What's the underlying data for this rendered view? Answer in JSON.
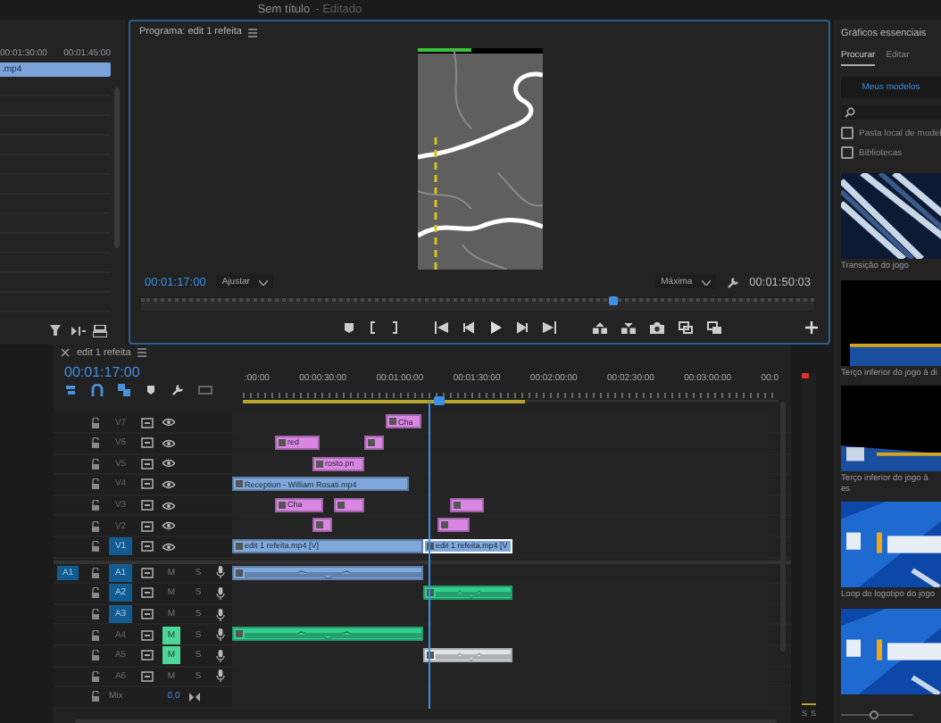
{
  "app_title": {
    "name": "Sem título",
    "status": "- Editado"
  },
  "project_panel": {
    "ruler": [
      "00:01:30:00",
      "00:01:45:00"
    ],
    "clip": ".mp4"
  },
  "program_monitor": {
    "title": "Programa: edit 1 refeita",
    "timecode": "00:01:17:00",
    "fit": "Ajustar",
    "quality": "Máxima",
    "duration": "00:01:50:03",
    "scrubber": {
      "level": 0.7
    }
  },
  "timeline": {
    "tab": "edit 1 refeita",
    "timecode": "00:01:17:00",
    "ruler": [
      ":00:00",
      "00:00:30:00",
      "00:01:00:00",
      "00:01:30:00",
      "00:02:00:00",
      "00:02:30:00",
      "00:03:00:00",
      "00:0"
    ],
    "playhead": {
      "level": 0.366
    },
    "tracks": [
      {
        "label": "V7",
        "kind": "video",
        "targeted": false,
        "clips": [
          {
            "kind": "graphic",
            "label": "Cha",
            "color": "#d986e2",
            "selected": false
          }
        ]
      },
      {
        "label": "V6",
        "kind": "video",
        "targeted": false,
        "clips": [
          {
            "kind": "graphic",
            "label": "red",
            "color": "#d986e2",
            "selected": false
          },
          {
            "kind": "graphic",
            "color": "#d986e2",
            "selected": false
          }
        ]
      },
      {
        "label": "V5",
        "kind": "video",
        "targeted": false,
        "clips": [
          {
            "kind": "graphic",
            "label": "rosto.pn",
            "color": "#d986e2",
            "selected": false
          }
        ]
      },
      {
        "label": "V4",
        "kind": "video",
        "targeted": false,
        "clips": [
          {
            "kind": "video",
            "label": "Reception - William Rosati.mp4",
            "color": "#7ea8dc",
            "selected": false
          }
        ]
      },
      {
        "label": "V3",
        "kind": "video",
        "targeted": false,
        "clips": [
          {
            "kind": "graphic",
            "label": "Cha",
            "color": "#d986e2",
            "selected": false
          },
          {
            "kind": "graphic",
            "color": "#d986e2",
            "selected": false
          },
          {
            "kind": "graphic",
            "color": "#d986e2",
            "selected": false
          }
        ]
      },
      {
        "label": "V2",
        "kind": "video",
        "targeted": false,
        "clips": [
          {
            "kind": "graphic",
            "color": "#d986e2",
            "selected": false
          },
          {
            "kind": "graphic",
            "color": "#d986e2",
            "selected": false
          }
        ]
      },
      {
        "label": "V1",
        "kind": "video",
        "targeted": true,
        "clips": [
          {
            "kind": "video",
            "label": "edit 1 refeita.mp4 [V]",
            "color": "#7ea8dc",
            "selected": false
          },
          {
            "kind": "video",
            "label": "edit 1 refeita.mp4 [V",
            "color": "#7ea8dc",
            "selected": true
          }
        ]
      },
      {
        "label": "A1",
        "kind": "audio",
        "targeted": true,
        "source": "A1",
        "mute_label": "M",
        "muted": false,
        "solo_label": "S",
        "clips": [
          {
            "kind": "audio",
            "color": "#7ea8dc",
            "selected": false
          }
        ]
      },
      {
        "label": "A2",
        "kind": "audio",
        "targeted": true,
        "mute_label": "M",
        "muted": false,
        "solo_label": "S",
        "clips": [
          {
            "kind": "audio",
            "color": "#31cf8e",
            "selected": false
          }
        ]
      },
      {
        "label": "A3",
        "kind": "audio",
        "targeted": true,
        "mute_label": "M",
        "muted": false,
        "solo_label": "S"
      },
      {
        "label": "A4",
        "kind": "audio",
        "targeted": false,
        "mute_label": "M",
        "muted": true,
        "solo_label": "S",
        "clips": [
          {
            "kind": "audio",
            "color": "#31cf8e",
            "selected": false
          }
        ]
      },
      {
        "label": "A5",
        "kind": "audio",
        "targeted": false,
        "mute_label": "M",
        "muted": true,
        "solo_label": "S",
        "clips": [
          {
            "kind": "audio",
            "color": "#dfe3e8",
            "selected": false
          }
        ]
      },
      {
        "label": "A6",
        "kind": "audio",
        "targeted": false,
        "mute_label": "M",
        "muted": false,
        "solo_label": "S"
      }
    ],
    "mix": {
      "label": "Mix",
      "value": "0,0"
    }
  },
  "audio_meter": {
    "labels": [
      "S",
      "S"
    ]
  },
  "essential_graphics": {
    "title": "Gráficos essenciais",
    "tabs": [
      {
        "label": "Procurar",
        "selected": true
      },
      {
        "label": "Editar",
        "selected": false
      }
    ],
    "button": "Meus modelos",
    "checkboxes": [
      {
        "label": "Pasta local de model",
        "checked": false
      },
      {
        "label": "Bibliotecas",
        "checked": false
      }
    ],
    "templates": [
      {
        "kind": "stripes",
        "caption": "Transição do jogo"
      },
      {
        "kind": "lower-third",
        "caption": "Terço inferior do jogo à di"
      },
      {
        "kind": "lower-third-tilted",
        "caption": "Terço inferior do jogo à es"
      },
      {
        "kind": "logo",
        "caption": "Loop do logotipo do jogo"
      },
      {
        "kind": "logo"
      }
    ],
    "size_slider": {
      "level": 0.45
    }
  }
}
